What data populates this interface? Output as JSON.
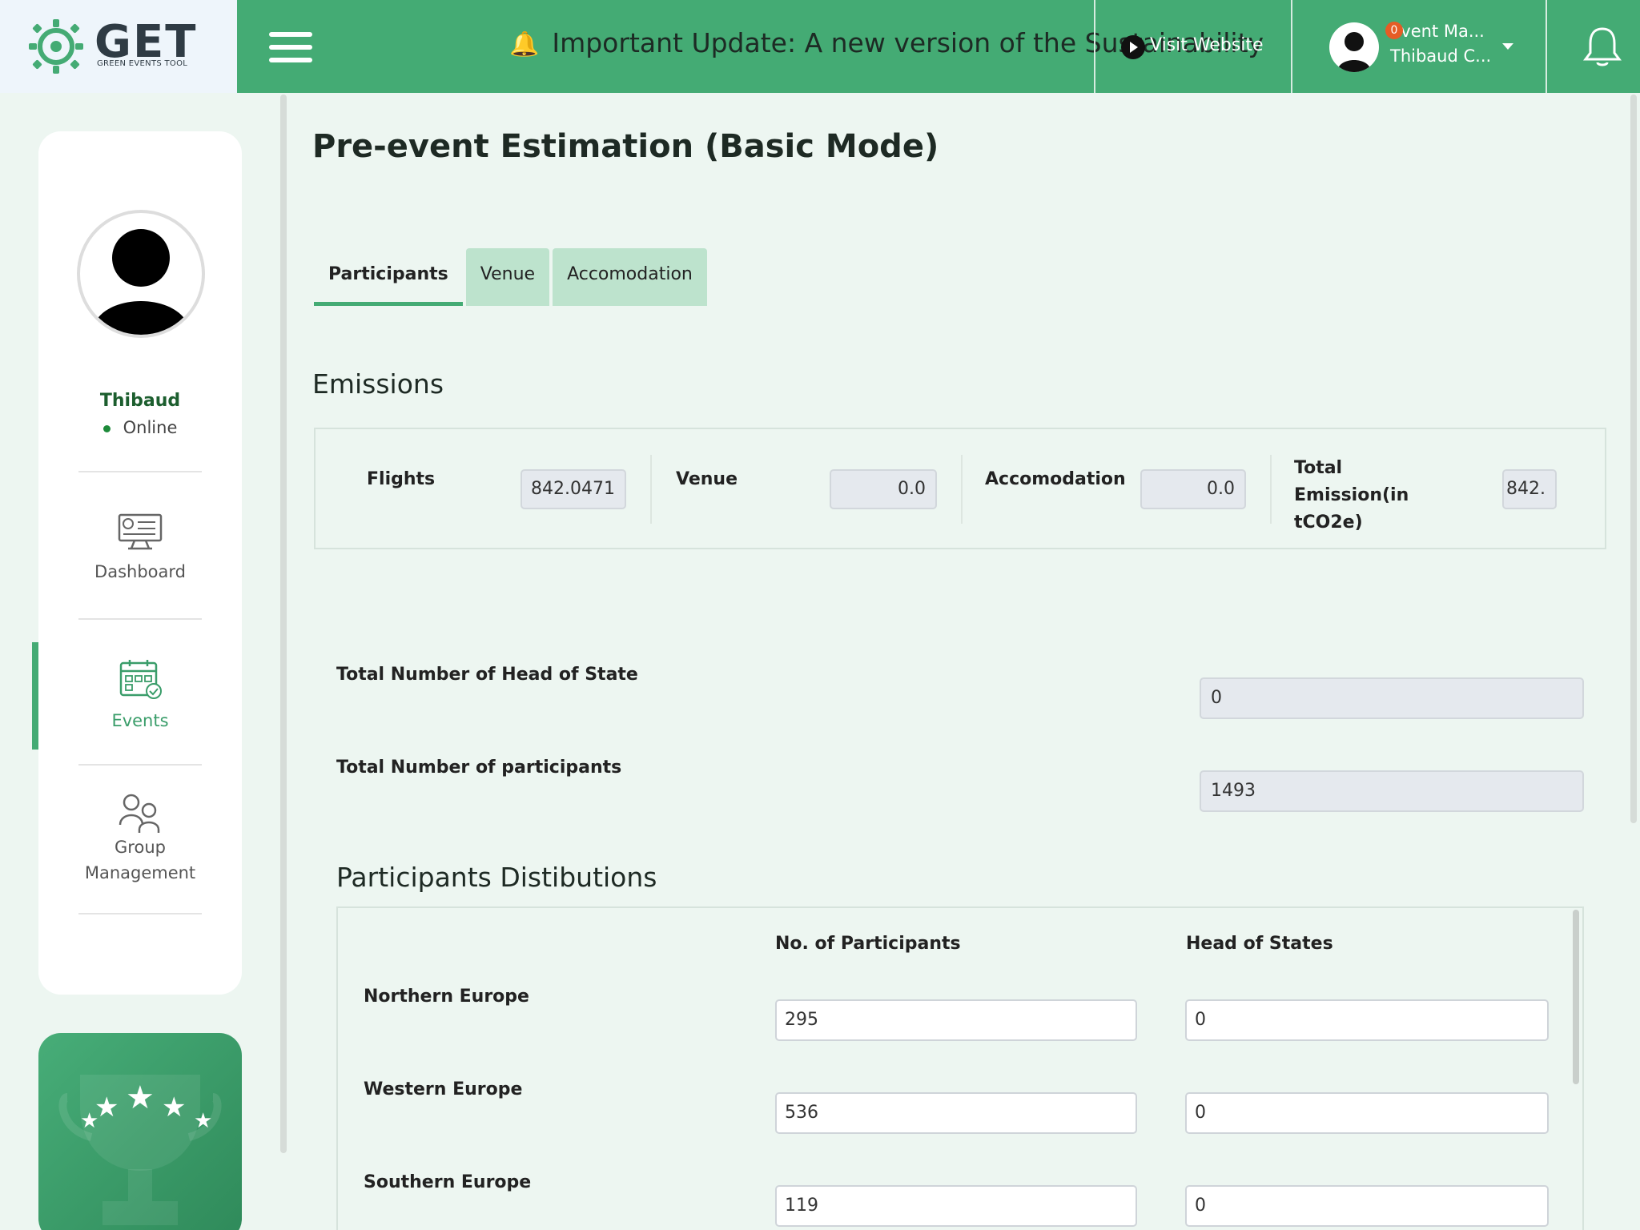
{
  "brand": {
    "name": "GET",
    "tagline": "GREEN EVENTS TOOL",
    "primary_color": "#44ab74"
  },
  "header": {
    "announcement": "Important Update: A new version of the Sustainability",
    "announcement_icon": "bell-emoji",
    "site_link_label": "Visit Website",
    "user_role": "Event Ma...",
    "user_name": "Thibaud C...",
    "notification_count": "0"
  },
  "sidebar": {
    "profile_name": "Thibaud",
    "profile_status": "Online",
    "items": [
      {
        "label": "Dashboard",
        "icon": "dashboard-icon",
        "active": false
      },
      {
        "label": "Events",
        "icon": "calendar-icon",
        "active": true
      },
      {
        "label": "Group Management",
        "icon": "group-icon",
        "active": false
      }
    ]
  },
  "main": {
    "title": "Pre-event Estimation (Basic Mode)",
    "tabs": [
      {
        "label": "Participants",
        "active": true
      },
      {
        "label": "Venue",
        "active": false
      },
      {
        "label": "Accomodation",
        "active": false
      }
    ],
    "emissions": {
      "heading": "Emissions",
      "items": [
        {
          "label": "Flights",
          "value": "842.0471"
        },
        {
          "label": "Venue",
          "value": "0.0"
        },
        {
          "label": "Accomodation",
          "value": "0.0"
        },
        {
          "label": "Total Emission(in tCO2e)",
          "value": "842."
        }
      ]
    },
    "totals": {
      "head_of_state_label": "Total Number of Head of State",
      "head_of_state_value": "0",
      "participants_label": "Total Number of participants",
      "participants_value": "1493"
    },
    "distributions": {
      "heading": "Participants Distibutions",
      "col_participants": "No. of Participants",
      "col_heads": "Head of States",
      "rows": [
        {
          "region": "Northern Europe",
          "participants": "295",
          "heads": "0"
        },
        {
          "region": "Western Europe",
          "participants": "536",
          "heads": "0"
        },
        {
          "region": "Southern Europe",
          "participants": "119",
          "heads": "0"
        }
      ]
    }
  }
}
